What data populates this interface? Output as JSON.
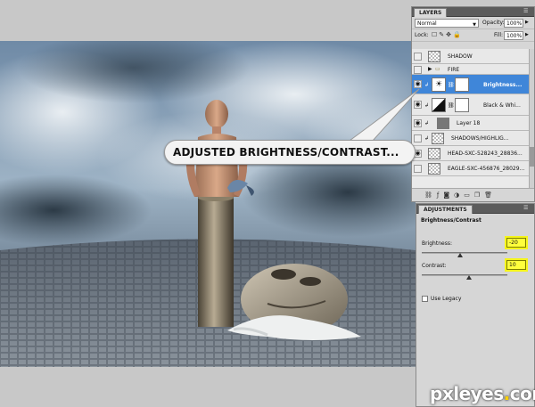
{
  "layers_panel": {
    "tab_label": "LAYERS",
    "blend_mode": "Normal",
    "opacity_label": "Opacity:",
    "opacity_value": "100%",
    "lock_label": "Lock:",
    "fill_label": "Fill:",
    "fill_value": "100%",
    "layers": [
      {
        "name": "SHADOW",
        "visible": false,
        "selected": false,
        "kind": "pixel"
      },
      {
        "name": "FIRE",
        "visible": false,
        "selected": false,
        "kind": "group"
      },
      {
        "name": "Brightness...",
        "visible": true,
        "selected": true,
        "kind": "adjustment"
      },
      {
        "name": "Black & Whi...",
        "visible": true,
        "selected": false,
        "kind": "adjustment"
      },
      {
        "name": "Layer 18",
        "visible": true,
        "selected": false,
        "kind": "pixel"
      },
      {
        "name": "SHADOWS/HIGHLIG...",
        "visible": false,
        "selected": false,
        "kind": "pixel"
      },
      {
        "name": "HEAD-SXC-528243_28836...",
        "visible": true,
        "selected": false,
        "kind": "pixel"
      },
      {
        "name": "EAGLE-SXC-456876_28029...",
        "visible": false,
        "selected": false,
        "kind": "pixel"
      }
    ]
  },
  "adjustments_panel": {
    "tab_label": "ADJUSTMENTS",
    "title": "Brightness/Contrast",
    "brightness_label": "Brightness:",
    "brightness_value": "-20",
    "contrast_label": "Contrast:",
    "contrast_value": "10",
    "brightness_fraction": 0.45,
    "contrast_fraction": 0.55,
    "use_legacy_label": "Use Legacy"
  },
  "callout": {
    "text": "ADJUSTED BRIGHTNESS/CONTRAST..."
  },
  "watermark": {
    "text_main": "pxleyes",
    "text_dot": ".",
    "text_tld": "com"
  },
  "colors": {
    "selection_blue": "#3f86d9",
    "highlight_yellow": "#ffff3c"
  }
}
